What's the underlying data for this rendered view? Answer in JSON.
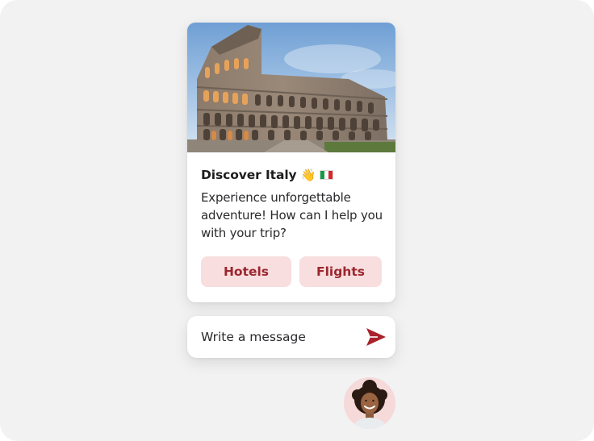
{
  "card": {
    "image": "colosseum-photo",
    "title": "Discover Italy",
    "title_emoji": "👋",
    "title_flag": "italy-flag-icon",
    "message": "Experience unforgettable\nadventure! How can I help you\nwith your trip?",
    "actions": [
      {
        "label": "Hotels"
      },
      {
        "label": "Flights"
      }
    ]
  },
  "composer": {
    "placeholder": "Write a message",
    "send_icon": "send-icon"
  },
  "colors": {
    "chip_background": "#f8dede",
    "chip_text": "#9b2630",
    "send_icon": "#a8232d",
    "avatar_ring": "#f6d9d9",
    "page_background": "#f2f2f3"
  }
}
